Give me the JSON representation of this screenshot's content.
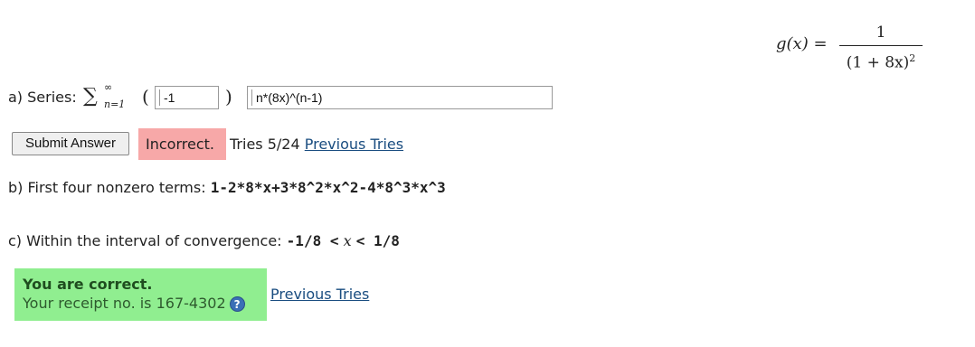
{
  "formula": {
    "lhs": "g(x) =",
    "numerator": "1",
    "denominator_main": "(1 + 8x)",
    "denominator_exp": "2"
  },
  "part_a": {
    "label": "a) Series:",
    "sigma": "∑",
    "sigma_upper": "∞",
    "sigma_lower": "n=1",
    "open_paren": "(",
    "close_paren": ")",
    "exponent": "n",
    "input1_value": "-1",
    "input2_value": "n*(8x)^(n-1)"
  },
  "submit": {
    "button_label": "Submit Answer",
    "status": "Incorrect.",
    "tries": "Tries 5/24",
    "previous_link": "Previous Tries"
  },
  "part_b": {
    "label": "b) First four nonzero terms:",
    "answer": "1-2*8*x+3*8^2*x^2-4*8^3*x^3"
  },
  "part_c": {
    "label": "c) Within the interval of convergence:",
    "answer_left": "-1/8 <",
    "answer_var": "x",
    "answer_right": "< 1/8"
  },
  "result": {
    "title": "You are correct.",
    "receipt": "Your receipt no. is 167-4302",
    "help_glyph": "?",
    "previous_link": "Previous Tries"
  }
}
